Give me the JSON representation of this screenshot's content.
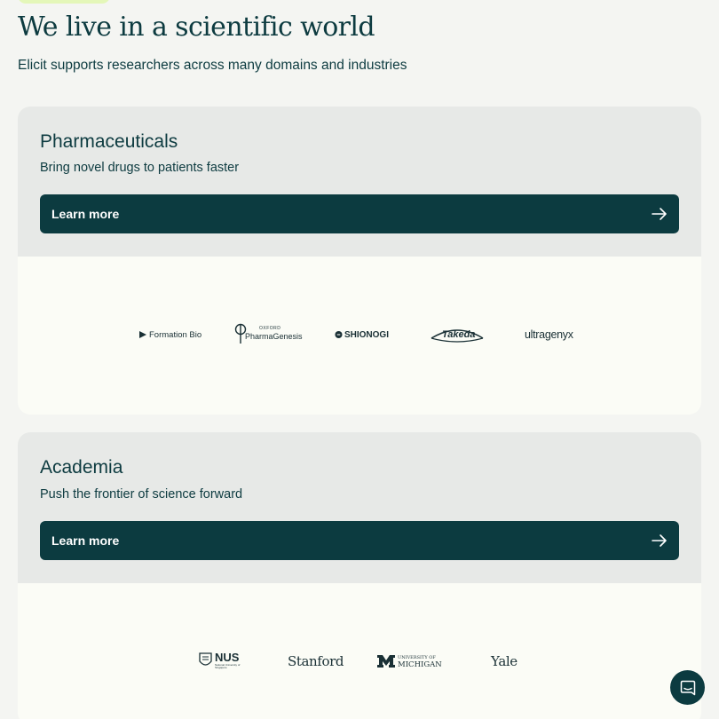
{
  "header": {
    "title": "We live in a scientific world",
    "subtitle": "Elicit supports researchers across many domains and industries"
  },
  "sections": [
    {
      "title": "Pharmaceuticals",
      "description": "Bring novel drugs to patients faster",
      "button_label": "Learn more",
      "logos": [
        {
          "name": "Formation Bio",
          "text": "Formation Bio"
        },
        {
          "name": "Oxford PharmaGenesis",
          "text_small": "OXFORD",
          "text": "PharmaGenesis"
        },
        {
          "name": "Shionogi",
          "text": "SHIONOGI"
        },
        {
          "name": "Takeda",
          "text": "Takeda"
        },
        {
          "name": "Ultragenyx",
          "text": "ultragenyx"
        }
      ]
    },
    {
      "title": "Academia",
      "description": "Push the frontier of science forward",
      "button_label": "Learn more",
      "logos": [
        {
          "name": "NUS",
          "text": "NUS",
          "text_small": "National University of Singapore"
        },
        {
          "name": "Stanford",
          "text": "Stanford"
        },
        {
          "name": "University of Michigan",
          "text_small": "UNIVERSITY OF",
          "text": "MICHIGAN"
        },
        {
          "name": "Yale",
          "text": "Yale"
        }
      ]
    }
  ],
  "icons": {
    "button_arrow": "arrow-right-icon",
    "chat": "chat-bubble-icon"
  },
  "colors": {
    "brand_dark": "#0c3b40",
    "card_head_bg": "#e7e9e7",
    "card_body_bg": "#fbfcf6",
    "page_bg": "#f4f5f2",
    "accent_pill": "#e4f7b9"
  }
}
